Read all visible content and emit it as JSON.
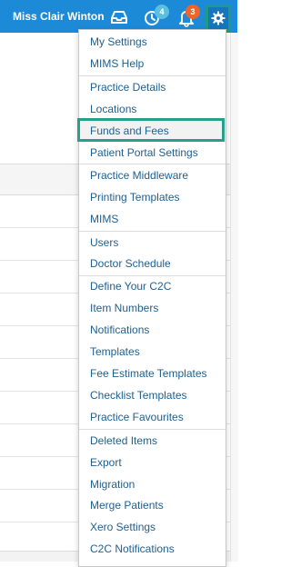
{
  "topbar": {
    "user_name": "Miss Clair Winton",
    "reminders_count": "4",
    "notifications_count": "3",
    "colors": {
      "bar": "#1d8ad8",
      "reminders_badge": "#5bc0de",
      "notifications_badge": "#f0622e",
      "highlight": "#26a08a"
    }
  },
  "settings_menu": {
    "items": [
      "My Settings",
      "MIMS Help",
      "Practice Details",
      "Locations",
      "Funds and Fees",
      "Patient Portal Settings",
      "Practice Middleware",
      "Printing Templates",
      "MIMS",
      "Users",
      "Doctor Schedule",
      "Define Your C2C",
      "Item Numbers",
      "Notifications",
      "Templates",
      "Fee Estimate Templates",
      "Checklist Templates",
      "Practice Favourites",
      "Deleted Items",
      "Export",
      "Migration",
      "Merge Patients",
      "Xero Settings",
      "C2C Notifications"
    ],
    "highlighted_item": "Funds and Fees"
  }
}
